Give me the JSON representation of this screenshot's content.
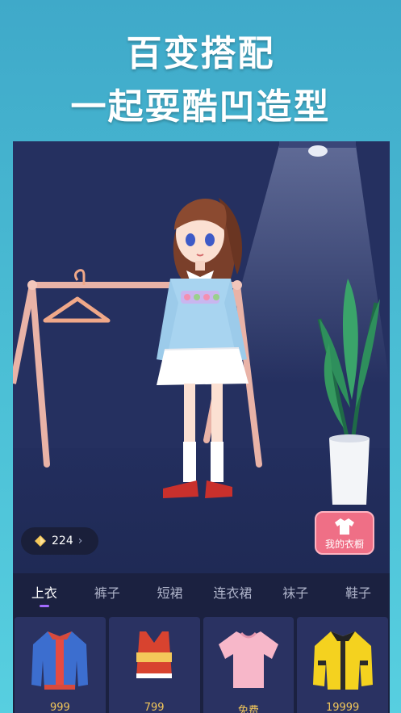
{
  "headline": {
    "line1": "百变搭配",
    "line2": "一起耍酷凹造型"
  },
  "wallet": {
    "coins": "224",
    "gem_icon": "diamond-icon",
    "chevron": "›"
  },
  "wardrobe_button": {
    "label": "我的衣橱",
    "icon": "shirt-icon"
  },
  "tabs": [
    {
      "label": "上衣",
      "active": true
    },
    {
      "label": "裤子"
    },
    {
      "label": "短裙"
    },
    {
      "label": "连衣裙"
    },
    {
      "label": "袜子"
    },
    {
      "label": "鞋子"
    }
  ],
  "items": [
    {
      "name": "jacket",
      "price": "999"
    },
    {
      "name": "crop-top",
      "price": "799"
    },
    {
      "name": "tshirt",
      "price": "免费"
    },
    {
      "name": "yellow-jacket",
      "price": "19999"
    }
  ],
  "colors": {
    "scene_bg": "#1f2a55",
    "tab_bg": "#1b2140",
    "card_bg": "#2a3262",
    "accent": "#a26bff",
    "price": "#f4c85a",
    "wardrobe_btn": "#ef6f86"
  }
}
